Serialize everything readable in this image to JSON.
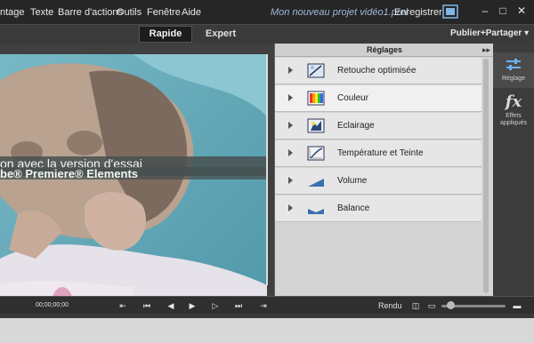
{
  "menu": {
    "items": [
      "ntage",
      "Texte",
      "Barre d'actions",
      "Outils",
      "Fenêtre",
      "Aide"
    ],
    "project_title": "Mon nouveau projet vidéo1.prel",
    "save_label": "Enregistrer",
    "minimize": "–",
    "maximize": "□",
    "close": "✕"
  },
  "modes": {
    "rapide": "Rapide",
    "expert": "Expert",
    "publish": "Publier+Partager ▾"
  },
  "video": {
    "watermark_line1": "on avec la version d'essai",
    "watermark_line2": "be® Premiere® Elements"
  },
  "panel": {
    "title": "Réglages",
    "collapse": "▸▸",
    "rows": [
      {
        "label": "Retouche optimisée",
        "icon": "auto-fix-icon"
      },
      {
        "label": "Couleur",
        "icon": "color-icon"
      },
      {
        "label": "Eclairage",
        "icon": "lighting-icon"
      },
      {
        "label": "Température et Teinte",
        "icon": "temperature-icon"
      },
      {
        "label": "Volume",
        "icon": "volume-icon"
      },
      {
        "label": "Balance",
        "icon": "balance-icon"
      }
    ]
  },
  "tools": {
    "reglage": "Réglage",
    "effets_line1": "Effets",
    "effets_line2": "appliqués",
    "fx": "fx"
  },
  "transport": {
    "timecode": "00;00;00;00",
    "rendu": "Rendu",
    "zoom_level": 0.14
  }
}
